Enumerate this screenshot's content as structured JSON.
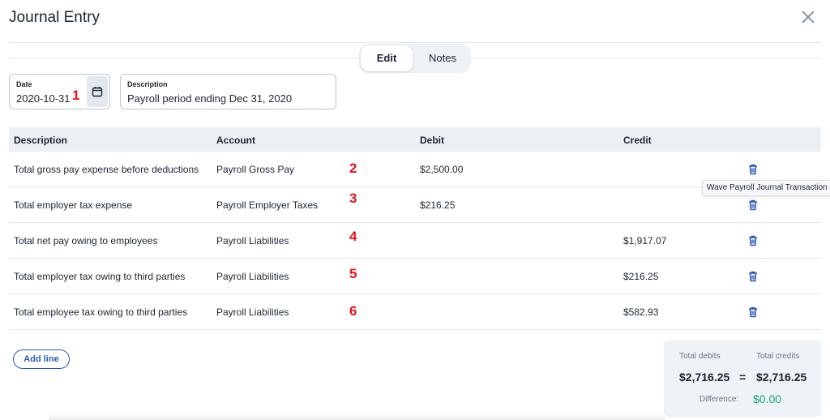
{
  "header": {
    "title": "Journal Entry"
  },
  "tabs": [
    {
      "label": "Edit",
      "active": true
    },
    {
      "label": "Notes",
      "active": false
    }
  ],
  "date_field": {
    "label": "Date",
    "value": "2020-10-31"
  },
  "description_field": {
    "label": "Description",
    "value": "Payroll period ending Dec 31, 2020"
  },
  "markers": [
    "1",
    "2",
    "3",
    "4",
    "5",
    "6"
  ],
  "table": {
    "columns": [
      "Description",
      "Account",
      "Debit",
      "Credit"
    ],
    "rows": [
      {
        "description": "Total gross pay expense before deductions",
        "account": "Payroll Gross Pay",
        "debit": "$2,500.00",
        "credit": ""
      },
      {
        "description": "Total employer tax expense",
        "account": "Payroll Employer Taxes",
        "debit": "$216.25",
        "credit": ""
      },
      {
        "description": "Total net pay owing to employees",
        "account": "Payroll Liabilities",
        "debit": "",
        "credit": "$1,917.07"
      },
      {
        "description": "Total employer tax owing to third parties",
        "account": "Payroll Liabilities",
        "debit": "",
        "credit": "$216.25"
      },
      {
        "description": "Total employee tax owing to third parties",
        "account": "Payroll Liabilities",
        "debit": "",
        "credit": "$582.93"
      }
    ]
  },
  "tooltip": {
    "text": "Wave Payroll Journal Transaction"
  },
  "actions": {
    "add_line_label": "Add line"
  },
  "totals": {
    "debits_label": "Total debits",
    "credits_label": "Total credits",
    "debits_value": "$2,716.25",
    "equals": "=",
    "credits_value": "$2,716.25",
    "difference_label": "Difference:",
    "difference_value": "$0.00"
  },
  "colors": {
    "accent": "#2a55b8",
    "marker": "#e3141c",
    "difference": "#1aa36b"
  },
  "icons": {
    "close": "close-icon",
    "calendar": "calendar-icon",
    "delete": "trash-icon"
  }
}
